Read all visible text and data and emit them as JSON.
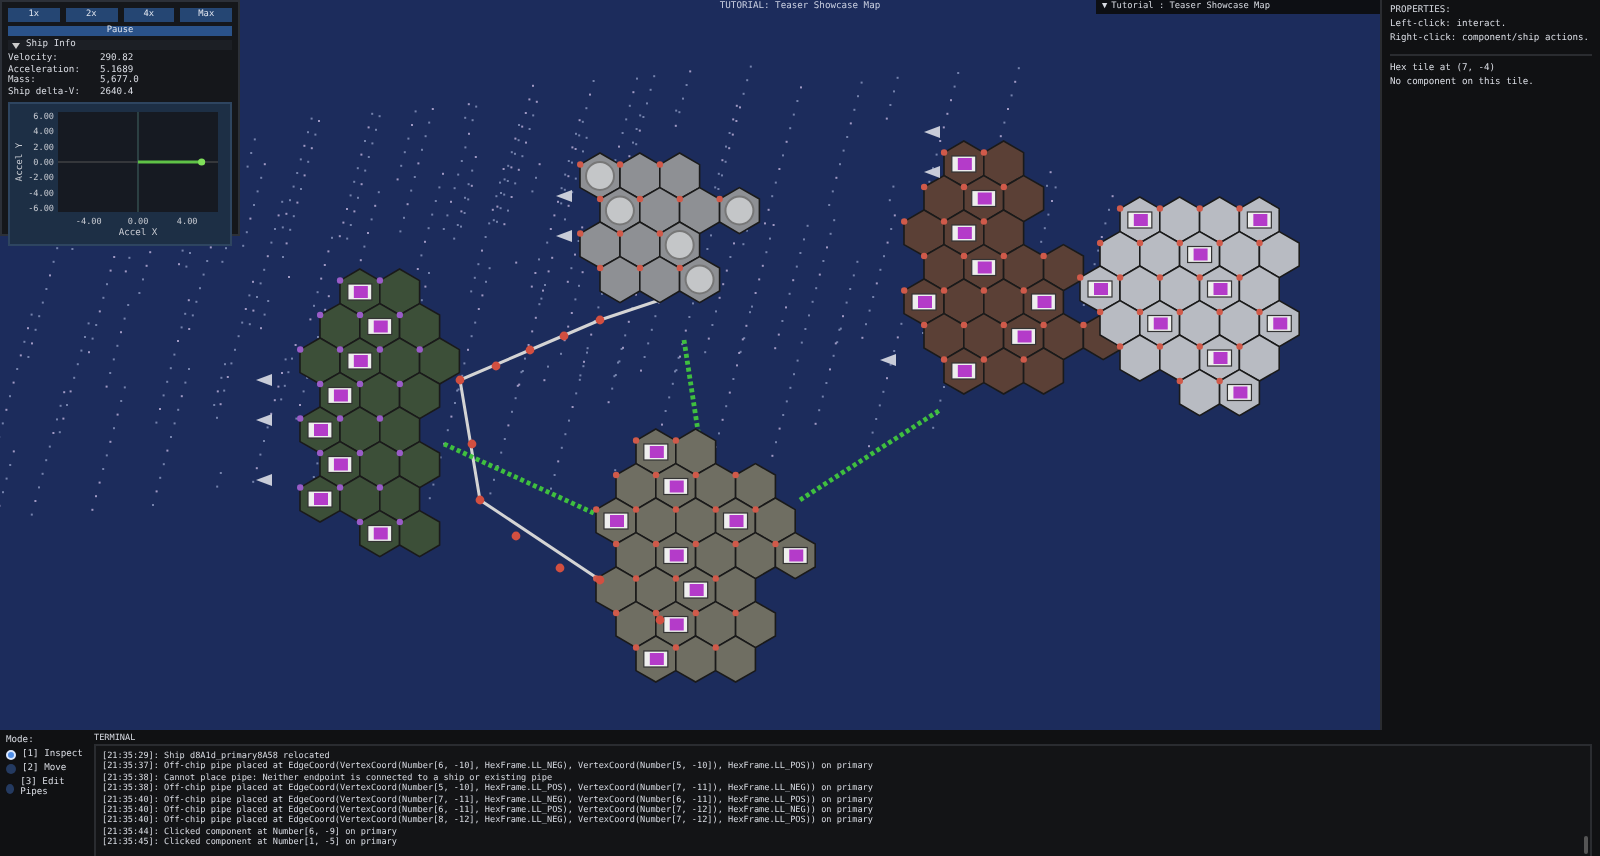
{
  "map_title": "TUTORIAL: Teaser Showcase Map",
  "window_tab": {
    "arrow": "▼",
    "label": "Tutorial : Teaser Showcase Map"
  },
  "speed_buttons": [
    {
      "label": "1x",
      "selected": false
    },
    {
      "label": "2x",
      "selected": false
    },
    {
      "label": "4x",
      "selected": false
    },
    {
      "label": "Max",
      "selected": false
    }
  ],
  "pause_button": "Pause",
  "ship_info": {
    "title": "Ship Info",
    "expanded": true,
    "stats": [
      {
        "label": "Velocity:",
        "value": "290.82"
      },
      {
        "label": "Acceleration:",
        "value": "5.1689"
      },
      {
        "label": "Mass:",
        "value": "5,677.0"
      },
      {
        "label": "Ship delta-V:",
        "value": "2640.4"
      }
    ],
    "chart_data": {
      "type": "scatter",
      "xlabel": "Accel X",
      "ylabel": "Accel Y",
      "x": [
        5.17
      ],
      "values": [
        0
      ],
      "xlim": [
        -6.5,
        6.5
      ],
      "ylim": [
        -6.5,
        6.5
      ],
      "xticks": [
        {
          "value": -4,
          "label": "-4.00"
        },
        {
          "value": 0,
          "label": "0.00"
        },
        {
          "value": 4,
          "label": "4.00"
        }
      ],
      "yticks": [
        {
          "value": 6,
          "label": "6.00"
        },
        {
          "value": 4,
          "label": "4.00"
        },
        {
          "value": 2,
          "label": "2.00"
        },
        {
          "value": 0,
          "label": "0.00"
        },
        {
          "value": -2,
          "label": "-2.00"
        },
        {
          "value": -4,
          "label": "-4.00"
        },
        {
          "value": -6,
          "label": "-6.00"
        }
      ]
    }
  },
  "properties": {
    "title": "PROPERTIES:",
    "hints": [
      "Left-click: interact.",
      "Right-click: component/ship actions."
    ],
    "details": [
      "Hex tile at (7, -4)",
      "No component on this tile."
    ]
  },
  "mode": {
    "title": "Mode:",
    "options": [
      {
        "label": "[1] Inspect",
        "selected": true
      },
      {
        "label": "[2] Move",
        "selected": false
      },
      {
        "label": "[3] Edit Pipes",
        "selected": false
      }
    ]
  },
  "terminal": {
    "title": "TERMINAL",
    "lines": [
      "[21:35:29]: Ship d8A1d_primary8A58 relocated",
      "[21:35:37]: Off-chip pipe placed at EdgeCoord(VertexCoord(Number[6, -10], HexFrame.LL_NEG), VertexCoord(Number[5, -10]), HexFrame.LL_POS)) on primary",
      "[21:35:38]: Cannot place pipe: Neither endpoint is connected to a ship or existing pipe",
      "[21:35:38]: Off-chip pipe placed at EdgeCoord(VertexCoord(Number[5, -10], HexFrame.LL_POS), VertexCoord(Number[7, -11]), HexFrame.LL_NEG)) on primary",
      "[21:35:40]: Off-chip pipe placed at EdgeCoord(VertexCoord(Number[7, -11], HexFrame.LL_NEG), VertexCoord(Number[6, -11]), HexFrame.LL_POS)) on primary",
      "[21:35:40]: Off-chip pipe placed at EdgeCoord(VertexCoord(Number[6, -11], HexFrame.LL_POS), VertexCoord(Number[7, -12]), HexFrame.LL_NEG)) on primary",
      "[21:35:40]: Off-chip pipe placed at EdgeCoord(VertexCoord(Number[8, -12], HexFrame.LL_NEG), VertexCoord(Number[7, -12]), HexFrame.LL_POS)) on primary",
      "[21:35:44]: Clicked component at Number[6, -9] on primary",
      "[21:35:45]: Clicked component at Number[1, -5] on primary"
    ]
  }
}
